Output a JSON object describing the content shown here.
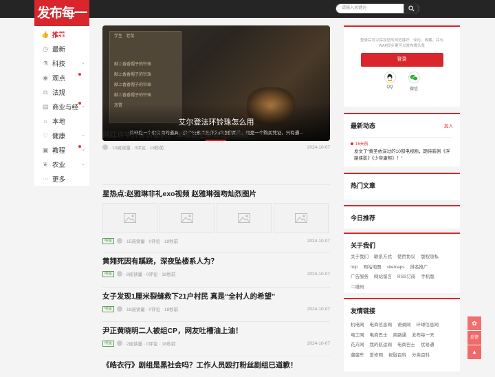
{
  "logo": "发布每一天",
  "search": {
    "placeholder": "请输入关键词"
  },
  "nav": [
    {
      "label": "推荐",
      "icon": "thumbs-up-icon",
      "active": true,
      "chev": false,
      "dot": false
    },
    {
      "label": "最新",
      "icon": "clock-icon",
      "active": false,
      "chev": false,
      "dot": false
    },
    {
      "label": "科技",
      "icon": "lab-icon",
      "active": false,
      "chev": true,
      "dot": false
    },
    {
      "label": "观点",
      "icon": "eye-icon",
      "active": false,
      "chev": false,
      "dot": true
    },
    {
      "label": "法规",
      "icon": "gavel-icon",
      "active": false,
      "chev": false,
      "dot": false
    },
    {
      "label": "商业与经",
      "icon": "chart-icon",
      "active": false,
      "chev": true,
      "dot": true
    },
    {
      "label": "本地",
      "icon": "location-icon",
      "active": false,
      "chev": false,
      "dot": false
    },
    {
      "label": "健康",
      "icon": "heart-icon",
      "active": false,
      "chev": true,
      "dot": false
    },
    {
      "label": "教程",
      "icon": "book-icon",
      "active": false,
      "chev": true,
      "dot": true
    },
    {
      "label": "农业",
      "icon": "leaf-icon",
      "active": false,
      "chev": true,
      "dot": false
    },
    {
      "label": "更多",
      "icon": "more-icon",
      "active": false,
      "chev": false,
      "dot": false
    }
  ],
  "slider": {
    "wall_lines": [
      "学生 · 老鼠",
      "献上香香帽子的铃珠",
      "献上香香帽子的铃珠",
      "献上香香帽子的铃珠",
      "献上香香帽子的铃珠",
      "放置"
    ],
    "title": "艾尔登法环铃珠怎么用",
    "subtitle": "铃珠是一个很有用的道具，这个玩意不是作为卢恩使用的，而是一个购买凭证，只有通..."
  },
  "articles": [
    {
      "title": "网红许华升身价被扒， 草根出生走红让人佩服",
      "tag": "",
      "reads": "· 10阅读量",
      "comments": "· 0评论",
      "time": "· 18秒前",
      "date": "2024-10-07",
      "thumbs": false
    },
    {
      "title": "星热点:赵雅琳非礼exo视频 赵雅琳强吻灿烈图片",
      "tag": "明星",
      "reads": "· 15阅读量",
      "comments": "· 0评论",
      "time": "· 18秒前",
      "date": "2024-10-07",
      "thumbs": true
    },
    {
      "title": "黄翙死因有蹊跷，深夜坠楼系人为？",
      "tag": "明星",
      "reads": "· 8阅读量",
      "comments": "· 0评论",
      "time": "· 18秒前",
      "date": "2024-10-07",
      "thumbs": false
    },
    {
      "title": "女子发现1厘米裂缝救下21户村民 真是“全村人的希望”",
      "tag": "明星",
      "reads": "· 19阅读量",
      "comments": "· 0评论",
      "time": "· 18秒前",
      "date": "2024-10-07",
      "thumbs": false
    },
    {
      "title": "尹正黄晓明二人被组CP，网友吐槽油上油！",
      "tag": "明星",
      "reads": "· 2阅读量",
      "comments": "· 0评论",
      "time": "· 18秒前",
      "date": "2024-10-07",
      "thumbs": false
    },
    {
      "title": "《皓衣行》剧组是黑社会吗？工作人员殴打粉丝剧组已道歉！",
      "tag": "",
      "reads": "",
      "comments": "",
      "time": "",
      "date": "",
      "thumbs": false
    }
  ],
  "login": {
    "tip": "登录后可以保存您的浏览喜好、评论、收藏，并与WAP同步更可以发布微头条",
    "button": "登录",
    "qq": "QQ",
    "wechat": "微信"
  },
  "latest": {
    "title": "最新动态",
    "add": "加入",
    "time": "16天前",
    "text": "发文了“黄圣依演过的10部电视剧，期待新剧《浮路侠影》《少帝康熙》！”"
  },
  "hot": {
    "title": "热门文章"
  },
  "today": {
    "title": "今日推荐"
  },
  "about": {
    "title": "关于我们",
    "links": [
      "关于我们",
      "联系方式",
      "使用协议",
      "版权隐私",
      "mip",
      "网站地图",
      "sitemaps",
      "排名推广",
      "广告服务",
      "网站留言",
      "RSS订阅",
      "手机版",
      "二维码"
    ]
  },
  "friends": {
    "title": "友情链接",
    "links": [
      "机电网",
      "电商信息网",
      "语录网",
      "环球信息网",
      "电工网",
      "电商巴士",
      "商路通",
      "发布每一天",
      "花卉网",
      "我的航运网",
      "电商巴士",
      "优易通",
      "遛遛车",
      "爱修网",
      "祝融百科",
      "分类百科"
    ]
  },
  "float": {
    "share_label": "",
    "feedback_label": "反馈"
  },
  "colors": {
    "accent": "#d8262c",
    "tag": "#5aa25a"
  }
}
